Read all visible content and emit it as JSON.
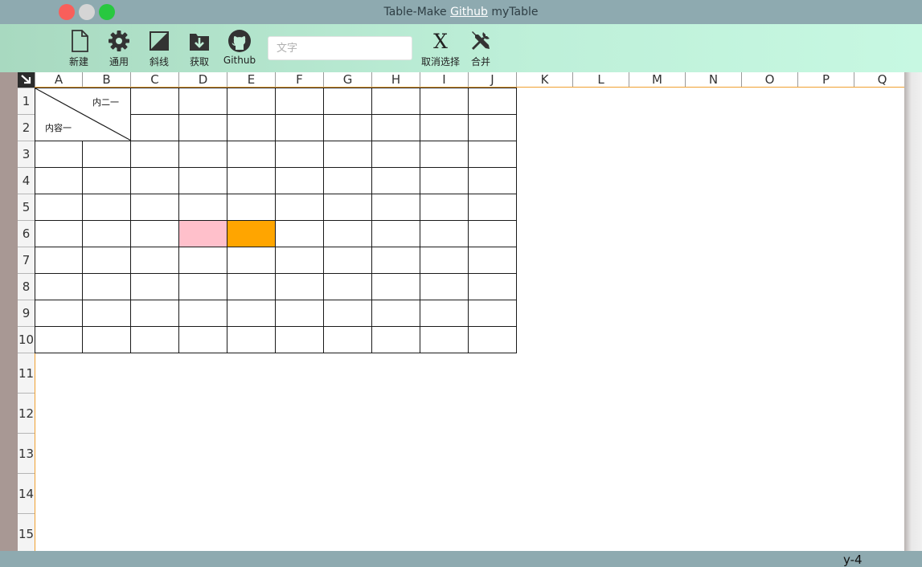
{
  "window": {
    "title_prefix": "Table-Make ",
    "title_link": "Github",
    "title_suffix": " myTable"
  },
  "toolbar": {
    "buttons": [
      {
        "label": "新建",
        "icon": "new-file-icon"
      },
      {
        "label": "通用",
        "icon": "gear-icon"
      },
      {
        "label": "斜线",
        "icon": "diagonal-icon"
      },
      {
        "label": "获取",
        "icon": "download-icon"
      },
      {
        "label": "Github",
        "icon": "github-icon"
      }
    ],
    "text_input": {
      "placeholder": "文字",
      "value": ""
    },
    "cancel_selection": {
      "label": "取消选择",
      "icon": "x-icon",
      "glyph": "X"
    },
    "merge": {
      "label": "合并",
      "icon": "tools-icon"
    }
  },
  "sheet": {
    "columns": [
      "A",
      "B",
      "C",
      "D",
      "E",
      "F",
      "G",
      "H",
      "I",
      "J",
      "K",
      "L",
      "M",
      "N",
      "O",
      "P",
      "Q"
    ],
    "rows": [
      "1",
      "2",
      "3",
      "4",
      "5",
      "6",
      "7",
      "8",
      "9",
      "10",
      "11",
      "12",
      "13",
      "14",
      "15"
    ],
    "diagonal_cell": {
      "top_right_text": "内二一",
      "bottom_left_text": "内容一"
    },
    "highlighted_cells": [
      {
        "cell": "D6",
        "color": "#ffc0cb"
      },
      {
        "cell": "E6",
        "color": "#ffa500"
      }
    ]
  },
  "status": {
    "text": "y-4"
  },
  "colors": {
    "titlebar": "#8eaab0",
    "accent_border": "#f0a030",
    "pink": "#ffc0cb",
    "orange": "#ffa500"
  }
}
